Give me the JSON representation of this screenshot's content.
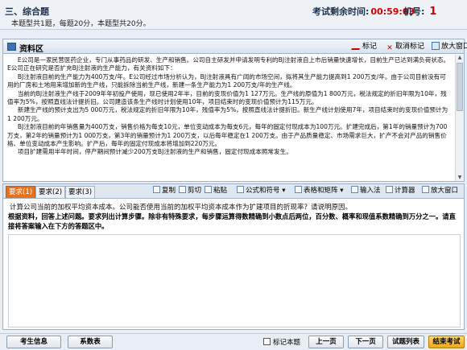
{
  "header": {
    "section_title": "三、综合题",
    "section_desc": "本题型共1题，每题20分，本题型共20分。",
    "timer_label": "考试剩余时间:",
    "timer_value": "00:59:03",
    "seat_label": "机号:",
    "seat_value": "1"
  },
  "material": {
    "title": "资料区",
    "toolbar": {
      "mark": "标记",
      "unmark": "取消标记",
      "enlarge": "放大窗口"
    },
    "paragraphs": [
      "E公司是一家民营医药企业，专门从事药品的研发、生产和销售。公司自主研发并申请发明专利的BJ注射液自上市后销量快速增长，目前生产已达到满负荷状态。E公司正在研究是否扩充BJ注射液的生产能力，有关资料如下：",
      "BJ注射液目前的生产能力为400万支/年。E公司经过市场分析认为，BJ注射液具有广阔的市场空间，拟将其生产能力提高到1 200万支/年。由于公司目前没有可用的厂房和土地用来增加新的生产线，只能拆除当前生产线，新建一条生产能力为1 200万支/年的生产线。",
      "当前的BJ注射液生产线于2009年年初投产使用，现已使用2年半，目前的变现价值为1 127万元。生产线的原值为1 800万元，税法规定的折旧年限为10年，残值率为5%，按照直线法计提折旧。公司建造该条生产线时计划使用10年，项目结束时的变现价值预计为115万元。",
      "新建生产线的预计支出为5 000万元，税法规定的折旧年限为10年，残值率为5%，按照直线法计提折旧。新生产线计划使用7年，项目结束时的变现价值预计为1 200万元。",
      "BJ注射液目前的年销售量为400万支，销售价格为每支10元，单位变动成本为每支6元，每年的固定付现成本为100万元。扩建完成后，第1年的销量预计为700万支，第2年的销量预计为1 000万支，第3年的销量预计为1 200万支，以后每年稳定在1 200万支。由于产品质量稳定、市场需求巨大，扩产不会对产品的销售价格、单位变动成本产生影响。扩产后，每年的固定付现成本将增加到220万元。",
      "项目扩建需用半年时间，停产期间预计减少200万支BJ注射液的生产和销售，固定付现成本照常发生。"
    ]
  },
  "requirement": {
    "tabs": [
      "要求(1)",
      "要求(2)",
      "要求(3)"
    ],
    "toolbar": {
      "copy": "复制",
      "cut": "剪切",
      "paste": "粘贴",
      "formula": "公式和符号",
      "table": "表格和矩阵",
      "input": "输入法",
      "calculator": "计算器",
      "enlarge": "放大窗口"
    },
    "question": "计算公司当前的加权平均资本成本。公司能否使用当前的加权平均资本成本作为扩建项目的折现率？请说明原因。",
    "note": "根据资料，回答上述问题。要求列出计算步骤。除非有特殊要求，每步骤运算得数精确到小数点后两位，百分数、概率和现值系数精确到万分之一。请直接将答案输入在下方的答题区中。",
    "answer": ""
  },
  "footer": {
    "candidate_info": "考生信息",
    "calculator": "系数表",
    "mark_label": "标记本题",
    "prev": "上一页",
    "next": "下一页",
    "list": "试题列表",
    "end": "结束考试"
  },
  "colors": {
    "accent": "#e8721c",
    "timer": "#d40000",
    "panel_border": "#9fb2c8"
  }
}
